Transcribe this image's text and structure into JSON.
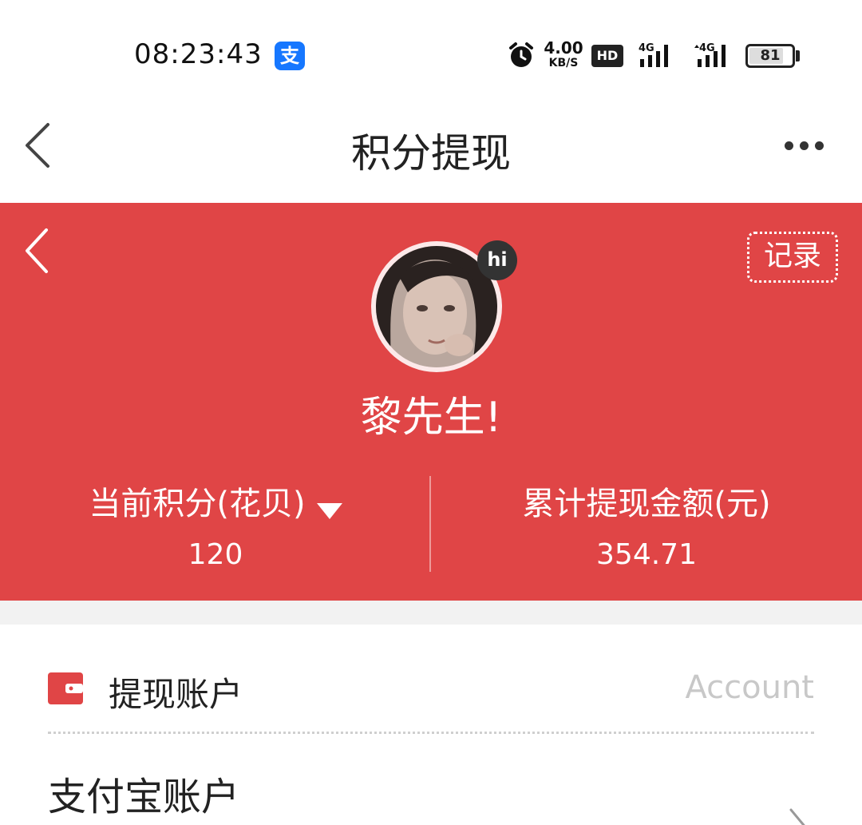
{
  "status_bar": {
    "time": "08:23:43",
    "alipay_glyph": "支",
    "net_speed_value": "4.00",
    "net_speed_unit": "KB/S",
    "hd_label": "HD",
    "signal_1_label": "4G",
    "signal_2_label": "4G",
    "battery_level": "81",
    "icons": [
      "alipay-icon",
      "alarm-clock-icon",
      "signal-icon",
      "battery-icon"
    ]
  },
  "nav": {
    "title": "积分提现",
    "back_icon": "chevron-left-icon",
    "more_icon": "more-dots-icon"
  },
  "hero": {
    "background_color": "#e04546",
    "record_label": "记录",
    "hi_badge": "hi",
    "user_name": "黎先生!",
    "stats": {
      "points_label": "当前积分(花贝)",
      "points_value": "120",
      "withdrawn_label": "累计提现金额(元)",
      "withdrawn_value": "354.71"
    }
  },
  "account_section": {
    "title": "提现账户",
    "subtitle": "Account",
    "wallet_icon_color": "#e04546",
    "rows": [
      {
        "label": "支付宝账户"
      }
    ]
  }
}
